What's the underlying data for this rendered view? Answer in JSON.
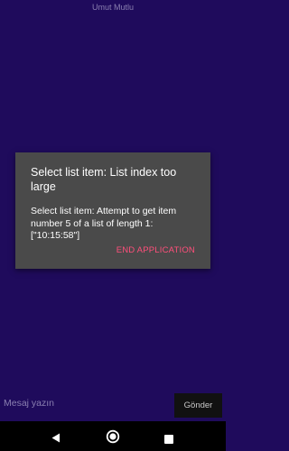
{
  "app": {
    "title": "Umut Mutlu"
  },
  "dialog": {
    "title": "Select list item: List index too large",
    "message": "Select list item: Attempt to get item number 5 of a list of length 1: [\"10:15:58\"]",
    "button_label": "END APPLICATION",
    "button_color": "#ff4f7b"
  },
  "composer": {
    "placeholder": "Mesaj yazın",
    "send_label": "Gönder"
  },
  "navbar": {
    "back_icon": "back-triangle-icon",
    "home_icon": "home-circle-icon",
    "recents_icon": "recents-square-icon"
  },
  "colors": {
    "background": "#1f0b5c",
    "dialog": "#4a4a4a",
    "accent": "#ff4f7b"
  }
}
